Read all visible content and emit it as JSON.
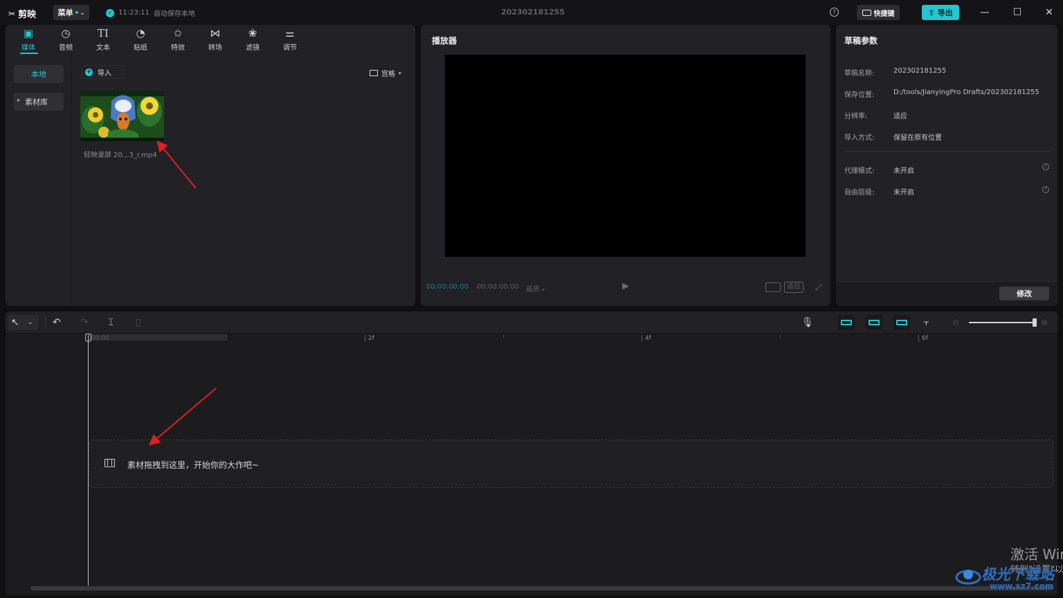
{
  "titlebar": {
    "app_name": "剪映",
    "menu_label": "菜单",
    "save_time": "11:23:11",
    "save_status": "自动保存本地",
    "project_name": "202302181255",
    "shortcut_label": "快捷键",
    "export_label": "导出",
    "minimize": "—",
    "maximize": "☐",
    "close": "✕"
  },
  "media": {
    "tabs": [
      {
        "label": "媒体",
        "icon": "media-icon",
        "active": true
      },
      {
        "label": "音频",
        "icon": "audio-icon"
      },
      {
        "label": "文本",
        "icon": "text-icon"
      },
      {
        "label": "贴纸",
        "icon": "sticker-icon"
      },
      {
        "label": "特效",
        "icon": "effects-icon"
      },
      {
        "label": "转场",
        "icon": "transition-icon"
      },
      {
        "label": "滤镜",
        "icon": "filter-icon"
      },
      {
        "label": "调节",
        "icon": "adjust-icon"
      }
    ],
    "side": {
      "local": "本地",
      "library": "素材库"
    },
    "import_label": "导入",
    "view_label": "宫格",
    "clip_name": "轻映录屏 20...3_r.mp4"
  },
  "player": {
    "title": "播放器",
    "current_time": "00:00:00:00",
    "total_time": "00:00:00:00",
    "speed_label": "画质",
    "fit_label": "适应"
  },
  "params": {
    "title": "草稿参数",
    "rows": [
      {
        "label": "草稿名称:",
        "value": "202302181255"
      },
      {
        "label": "保存位置:",
        "value": "D:/tools/JianyingPro Drafts/202302181255"
      },
      {
        "label": "分辨率:",
        "value": "适应"
      },
      {
        "label": "导入方式:",
        "value": "保留在原有位置"
      }
    ],
    "rows2": [
      {
        "label": "代理模式:",
        "value": "未开启"
      },
      {
        "label": "自由层级:",
        "value": "未开启"
      }
    ],
    "modify_label": "修改"
  },
  "timeline": {
    "ruler": [
      "00:00",
      "2f",
      "4f",
      "6f"
    ],
    "drop_hint": "素材拖拽到这里，开始你的大作吧~"
  },
  "watermark": {
    "activate": "激活 Win",
    "activate_sub": "转到\"设置\"以",
    "site_name": "极光下载站",
    "site_url": "www.xz7.com"
  },
  "colors": {
    "accent": "#22c7d0",
    "annotation_arrow": "#e02020"
  }
}
